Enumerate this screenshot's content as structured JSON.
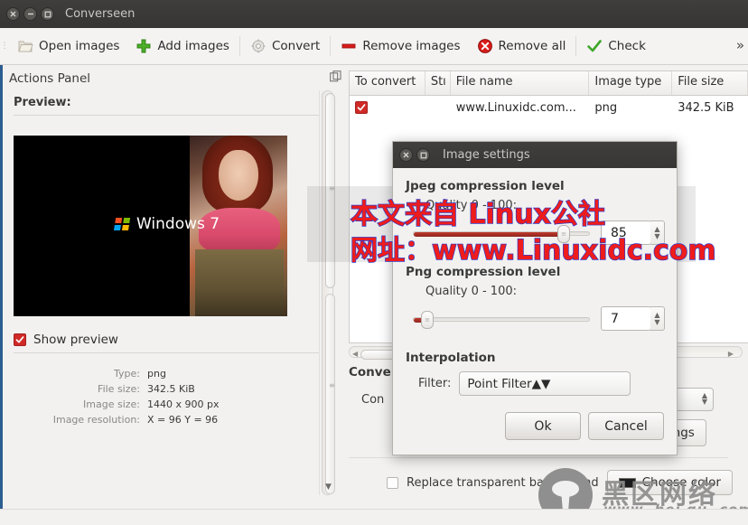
{
  "window": {
    "title": "Converseen",
    "buttons": {
      "close": "close-icon",
      "minimize": "minimize-icon",
      "maximize": "maximize-icon"
    }
  },
  "toolbar": {
    "items": [
      {
        "label": "Open images",
        "icon": "folder-open-icon"
      },
      {
        "label": "Add images",
        "icon": "plus-icon"
      },
      {
        "label": "Convert",
        "icon": "gear-icon"
      },
      {
        "label": "Remove images",
        "icon": "minus-icon"
      },
      {
        "label": "Remove all",
        "icon": "cancel-icon"
      },
      {
        "label": "Check",
        "icon": "checkmark-icon"
      }
    ],
    "overflow": "»"
  },
  "actions_panel": {
    "title": "Actions Panel",
    "preview_label": "Preview:",
    "preview_image": {
      "brand": "Windows 7"
    },
    "show_preview": {
      "label": "Show preview",
      "checked": true
    },
    "metadata": [
      {
        "key": "Type:",
        "value": "png"
      },
      {
        "key": "File size:",
        "value": "342.5 KiB"
      },
      {
        "key": "Image size:",
        "value": "1440 x 900 px"
      },
      {
        "key": "Image resolution:",
        "value": "X = 96 Y = 96"
      }
    ]
  },
  "file_table": {
    "columns": [
      "To convert",
      "Stı",
      "File name",
      "Image type",
      "File size"
    ],
    "rows": [
      {
        "to_convert": true,
        "status": "",
        "file_name": "www.Linuxidc.com...",
        "image_type": "png",
        "file_size": "342.5 KiB"
      }
    ]
  },
  "convert_options": {
    "section_title": "Conve",
    "row_label": "Con",
    "format_value": "",
    "settings_button": "settings",
    "replace_transparent": {
      "label": "Replace transparent background",
      "checked": false
    },
    "choose_color_button": "Choose color"
  },
  "dialog": {
    "title": "Image settings",
    "jpeg": {
      "section": "Jpeg compression level",
      "quality_label": "Quality 0 - 100:",
      "value": "85",
      "percent": 85
    },
    "png": {
      "section": "Png compression level",
      "quality_label": "Quality 0 - 100:",
      "value": "7",
      "percent": 7
    },
    "interpolation": {
      "section": "Interpolation",
      "filter_label": "Filter:",
      "filter_value": "Point Filter"
    },
    "ok_button": "Ok",
    "cancel_button": "Cancel"
  },
  "watermarks": {
    "red_line1": "本文来自 Linux公社",
    "red_line2": "网址：www.Linuxidc.com",
    "gray_cn": "黑区网络",
    "gray_url": "www. hei qu. com",
    "red_color": "#ee1c1c",
    "red_outline": "#2b3bd0",
    "gray_color": "#8d8d8d"
  }
}
